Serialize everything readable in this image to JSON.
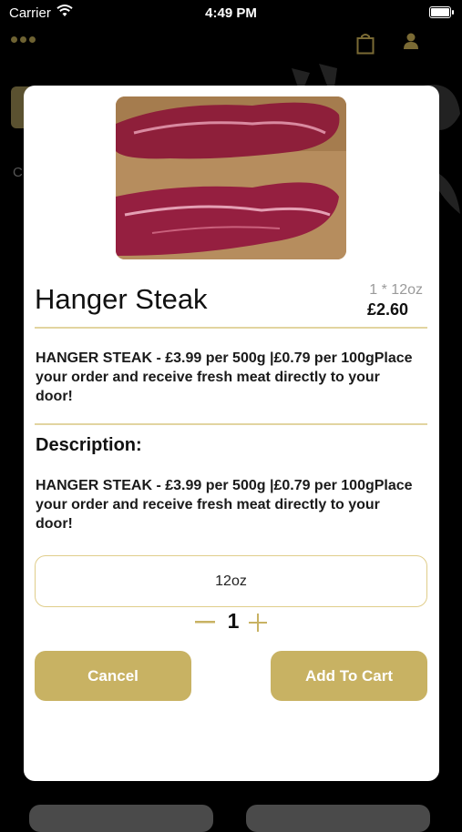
{
  "status_bar": {
    "carrier": "Carrier",
    "time": "4:49 PM"
  },
  "background": {
    "partial_text": "C"
  },
  "product": {
    "name": "Hanger Steak",
    "weight": "1 * 12oz",
    "price": "£2.60",
    "summary_bold": "HANGER STEAK - £3.99 per 500g |£0.79 per 100g",
    "summary_rest": "Place your order and receive fresh meat directly to your door!",
    "description_heading": "Description:",
    "description_bold": "HANGER STEAK - £3.99 per 500g |£0.79 per 100g",
    "description_rest": "Place your order and receive fresh meat directly to your door!"
  },
  "options": {
    "selected_size": "12oz",
    "quantity": "1"
  },
  "actions": {
    "cancel_label": "Cancel",
    "add_label": "Add To Cart"
  },
  "colors": {
    "accent": "#c8b263",
    "divider": "#e2d4a0"
  },
  "icons": [
    "wifi-icon",
    "battery-icon",
    "menu-dots-icon",
    "shopping-bag-icon",
    "person-icon",
    "minus-icon",
    "plus-icon"
  ]
}
